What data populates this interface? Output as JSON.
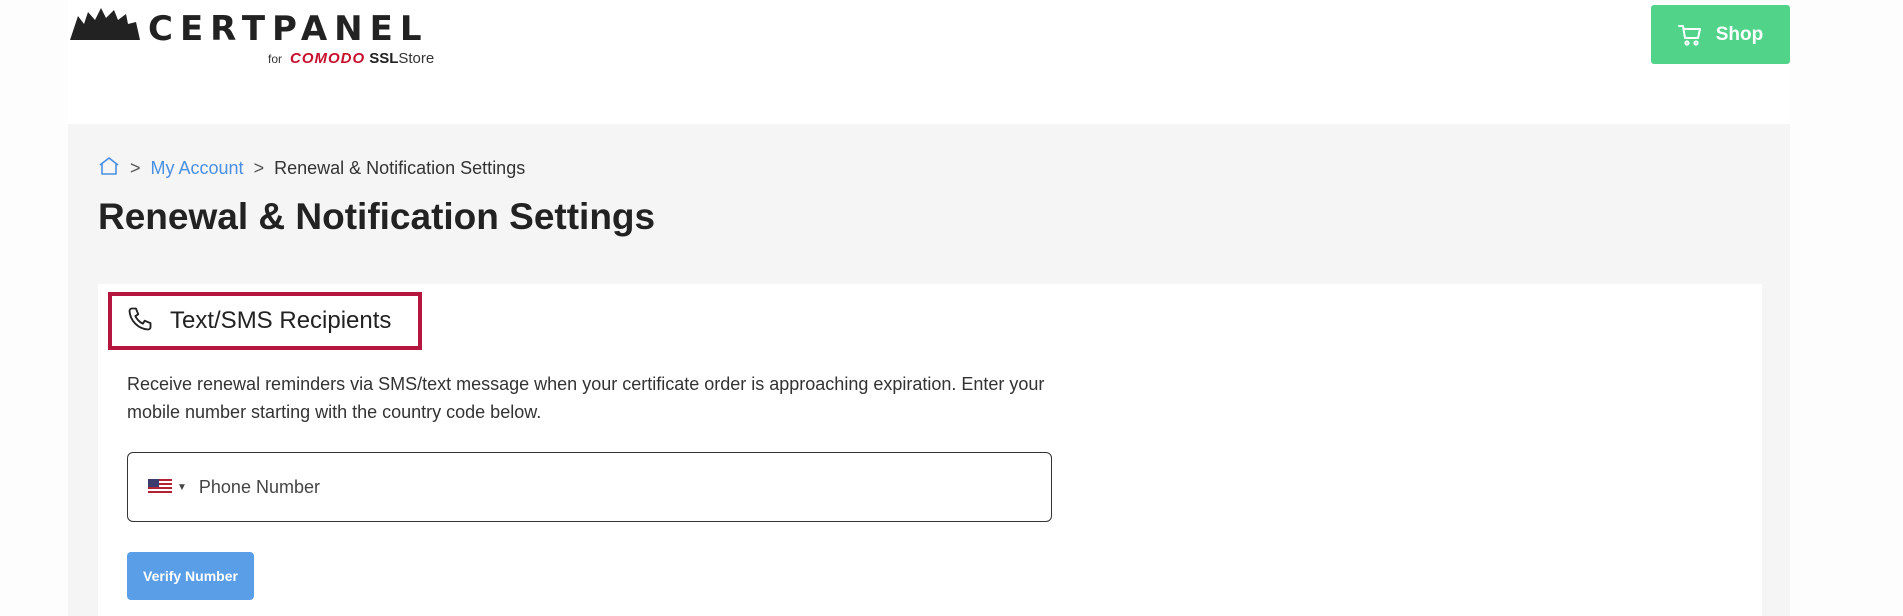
{
  "header": {
    "logo": {
      "wordmark": "CERTPANEL",
      "for_text": "for",
      "brand_text": "COMODO",
      "ssl_text": "SSL",
      "store_text": "Store"
    },
    "shop_button": {
      "label": "Shop",
      "icon": "cart-icon"
    }
  },
  "breadcrumb": {
    "home_icon": "home-icon",
    "separator": ">",
    "items": [
      {
        "label": "My Account"
      },
      {
        "label": "Renewal & Notification Settings"
      }
    ]
  },
  "page": {
    "title": "Renewal & Notification Settings"
  },
  "sms_section": {
    "icon": "phone-icon",
    "title": "Text/SMS Recipients",
    "description": "Receive renewal reminders via SMS/text message when your certificate order is approaching expiration. Enter your mobile number starting with the country code below.",
    "phone_field": {
      "country": "us-flag-icon",
      "placeholder": "Phone Number",
      "value": ""
    },
    "verify_button": {
      "label": "Verify Number"
    }
  },
  "colors": {
    "shop_green": "#52d38a",
    "highlight_red": "#b5163d",
    "link_blue": "#4a90e2",
    "button_blue": "#5b9ee8",
    "brand_red": "#c8102e"
  }
}
